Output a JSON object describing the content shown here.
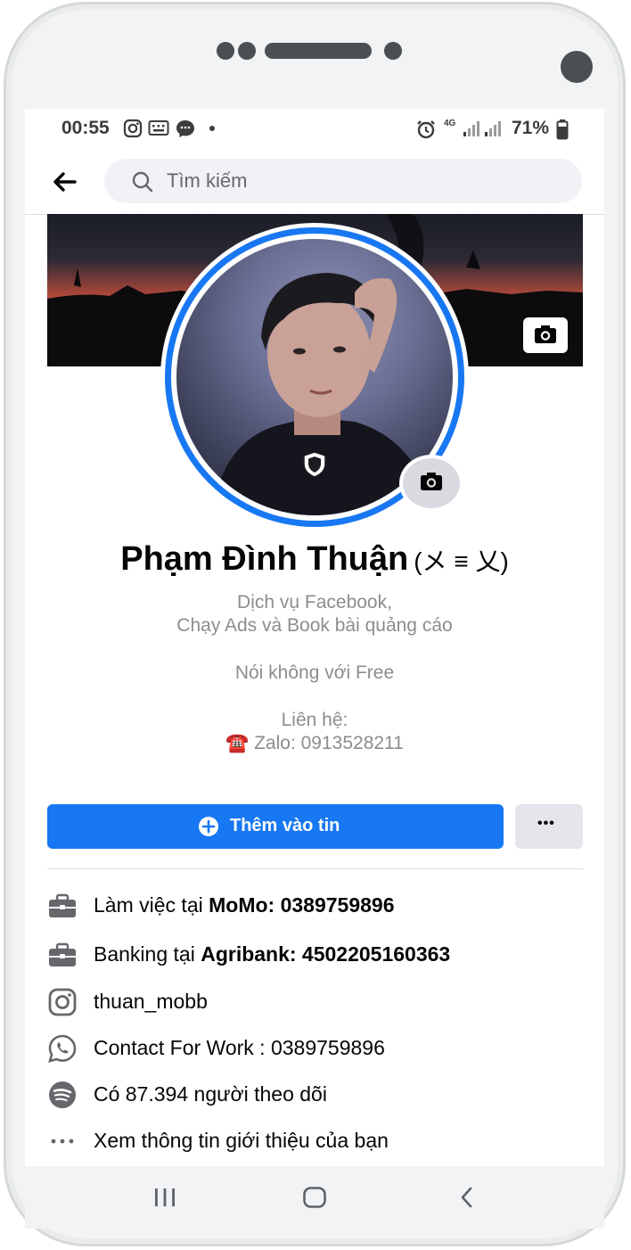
{
  "status": {
    "time": "00:55",
    "network": "4G",
    "battery": "71%"
  },
  "search": {
    "placeholder": "Tìm kiếm"
  },
  "profile": {
    "name": "Phạm Đình Thuận",
    "name_suffix": "(メ ≡ 乂)",
    "bio_line1": "Dịch vụ Facebook,",
    "bio_line2": "Chạy Ads và Book bài quảng cáo",
    "bio_line3": "Nói không với Free",
    "bio_line4": "Liên hệ:",
    "bio_line5": "☎️ Zalo: 0913528211"
  },
  "actions": {
    "add_story": "Thêm vào tin",
    "more": "•••"
  },
  "info": [
    {
      "prefix": "Làm việc tại ",
      "bold": "MoMo: 0389759896",
      "icon": "briefcase-icon"
    },
    {
      "prefix": "Banking tại ",
      "bold": "Agribank: 4502205160363",
      "icon": "briefcase-icon"
    },
    {
      "prefix": "thuan_mobb",
      "bold": "",
      "icon": "instagram-icon"
    },
    {
      "prefix": "Contact For Work : 0389759896",
      "bold": "",
      "icon": "whatsapp-icon"
    },
    {
      "prefix": "Có 87.394 người theo dõi",
      "bold": "",
      "icon": "spotify-icon"
    },
    {
      "prefix": "Xem thông tin giới thiệu của bạn",
      "bold": "",
      "icon": "more-dots-icon"
    }
  ],
  "colors": {
    "accent": "#1877f2",
    "text": "#050505",
    "secondary": "#8a8d91"
  }
}
